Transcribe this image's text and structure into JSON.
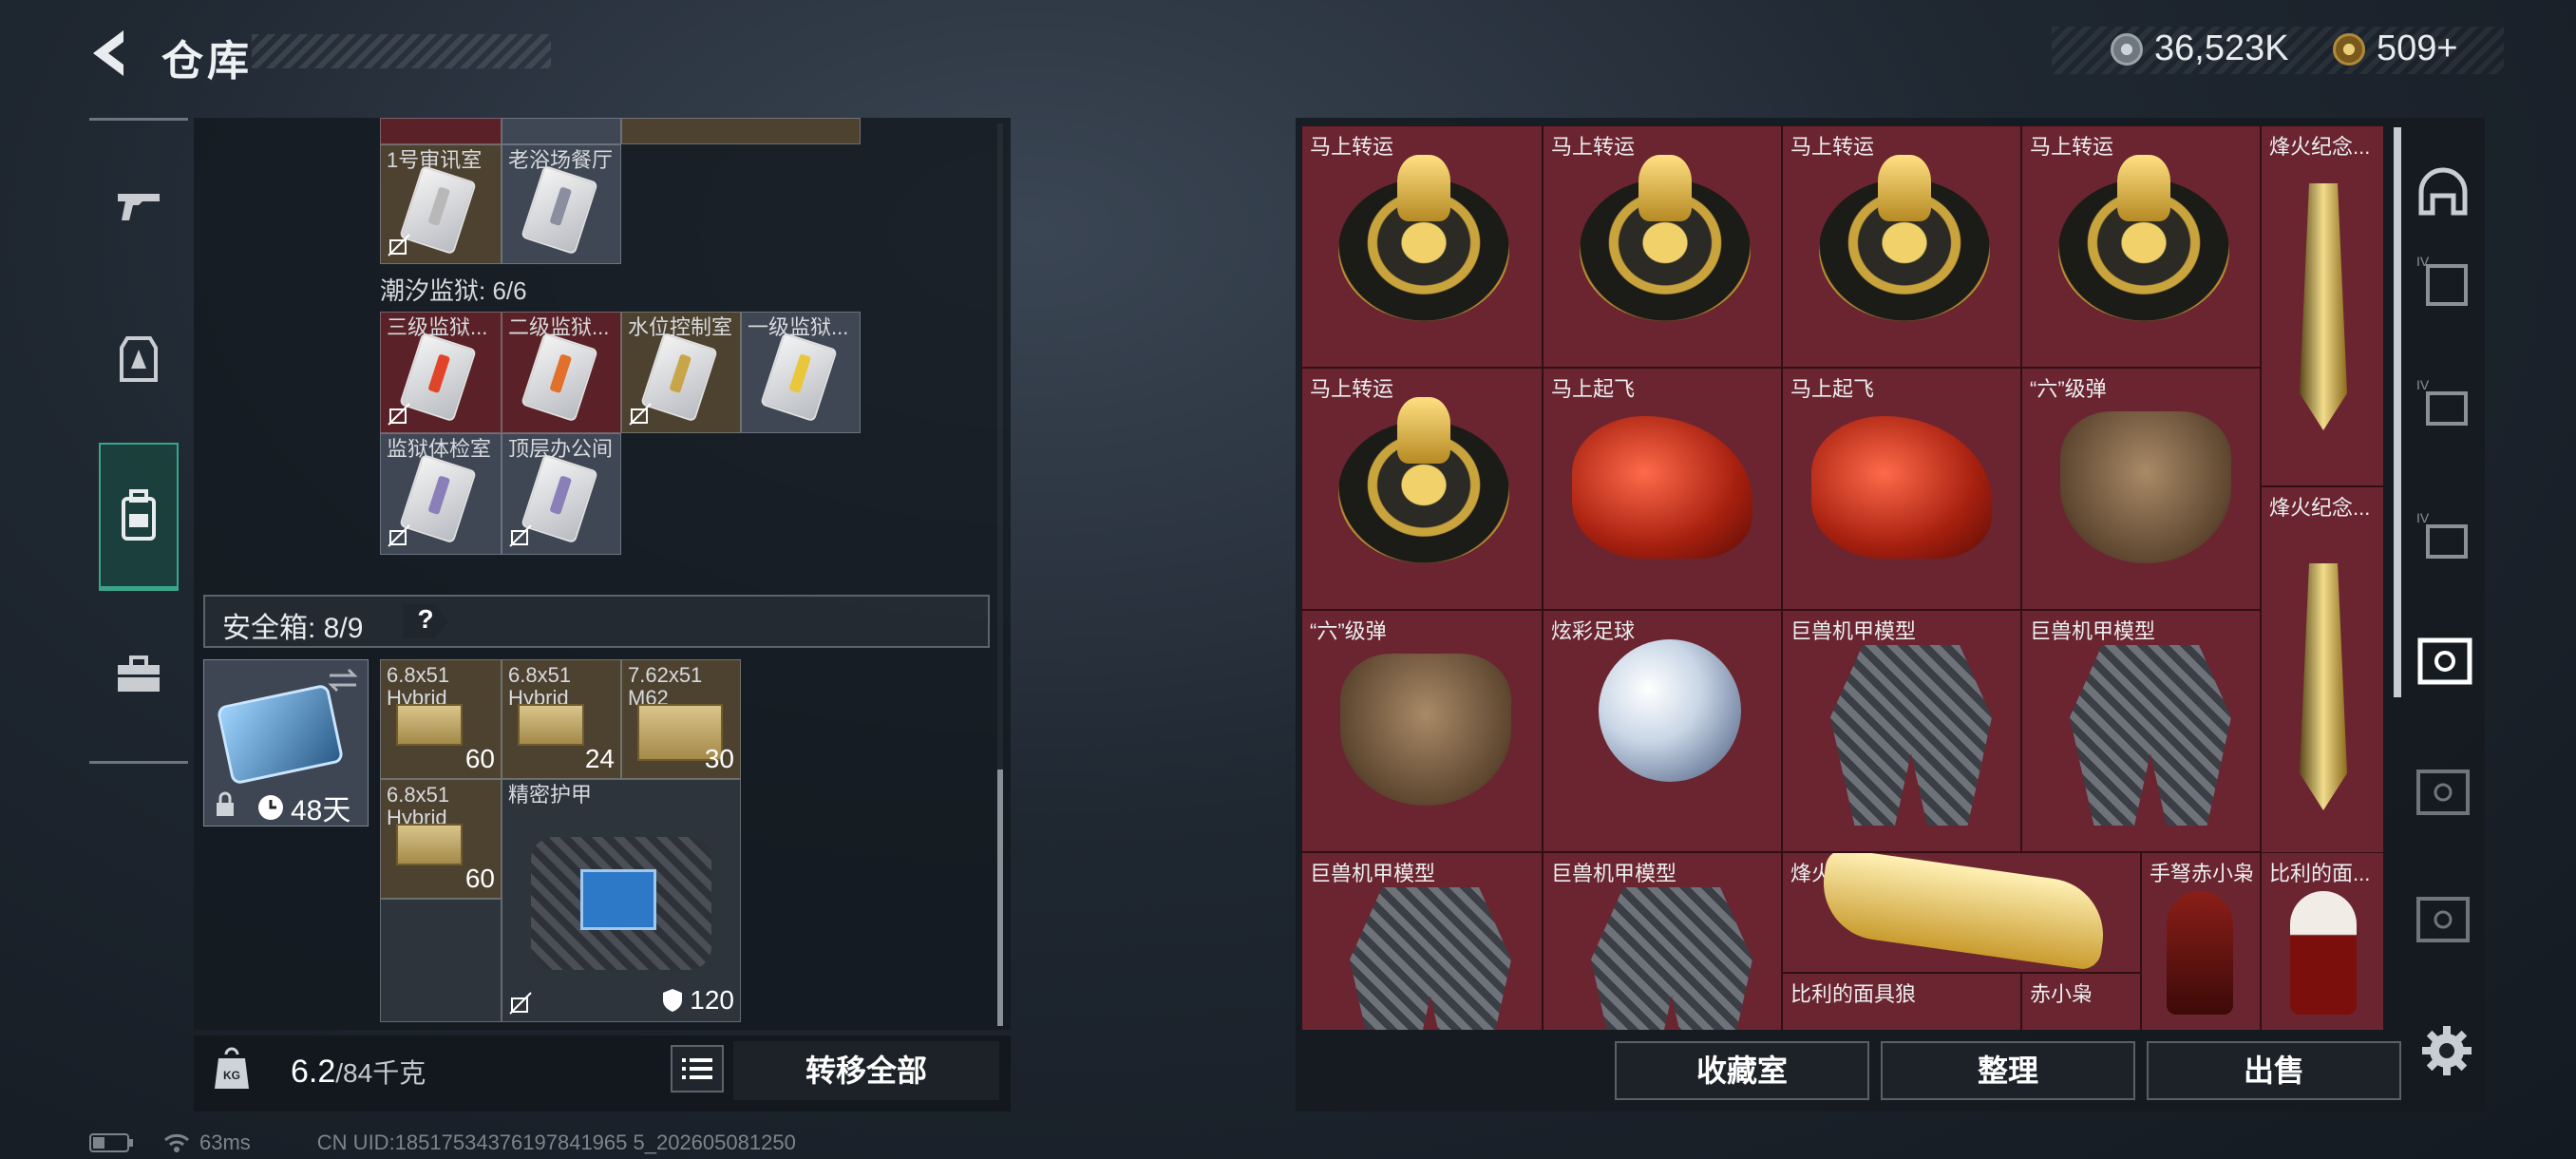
{
  "header": {
    "title": "仓库",
    "currency_silver": "36,523K",
    "currency_gold": "509+"
  },
  "left": {
    "top_cells": [
      "1号审讯室",
      "老浴场餐厅"
    ],
    "prison_group_title": "潮汐监狱: 6/6",
    "prison_cells": [
      "三级监狱...",
      "二级监狱...",
      "水位控制室",
      "一级监狱...",
      "监狱体检室",
      "顶层办公间"
    ],
    "safe_title": "安全箱: 8/9",
    "help": "?",
    "safebox_days": "48天",
    "safe_items": [
      {
        "label": "6.8x51\nHybrid",
        "qty": "60"
      },
      {
        "label": "6.8x51\nHybrid",
        "qty": "24"
      },
      {
        "label": "7.62x51\nM62",
        "qty": "30"
      },
      {
        "label": "6.8x51\nHybrid",
        "qty": "60"
      },
      {
        "label": "精密护甲",
        "qty": "120"
      }
    ],
    "weight_current": "6.2",
    "weight_total": "/84千克",
    "transfer_all": "转移全部"
  },
  "status": {
    "ping": "63ms",
    "uid": "CN UID:18517534376197841965 5_202605081250"
  },
  "right": {
    "items": [
      "马上转运",
      "马上转运",
      "马上转运",
      "马上转运",
      "烽火纪念...",
      "马上转运",
      "马上起飞",
      "马上起飞",
      "“六”级弹",
      "烽火纪念...",
      "“六”级弹",
      "炫彩足球",
      "巨兽机甲模型",
      "巨兽机甲模型",
      "巨兽机甲模型",
      "巨兽机甲模型",
      "烽火纪念奖杯",
      "手弩赤小枭",
      "比利的面...",
      "比利的面具狼",
      "赤小枭"
    ],
    "buttons": {
      "collection": "收藏室",
      "organize": "整理",
      "sell": "出售"
    }
  },
  "colors": {
    "accent": "#3aa58c",
    "item_bg": "#6b2530"
  }
}
